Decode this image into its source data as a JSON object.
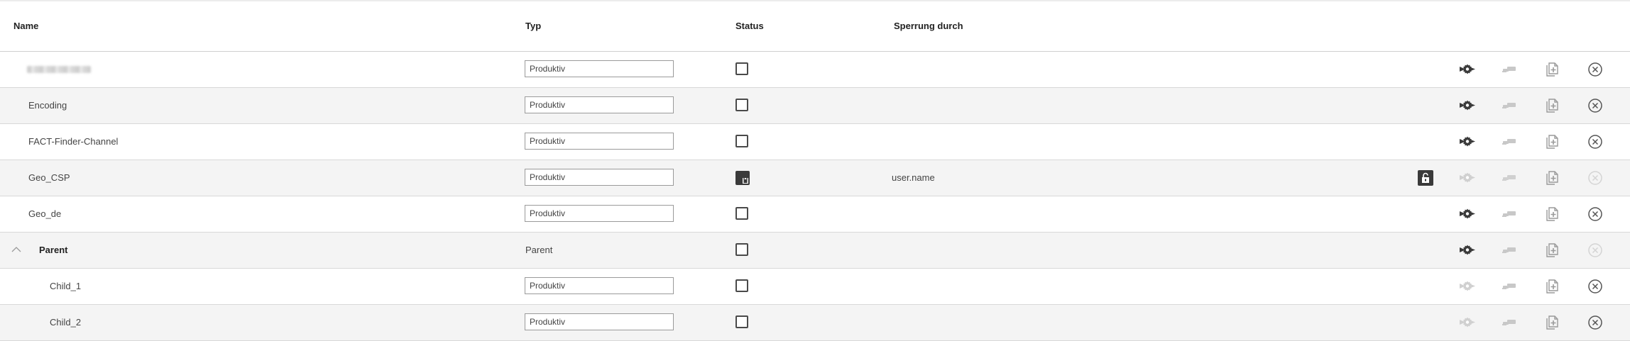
{
  "header": {
    "name": "Name",
    "typ": "Typ",
    "status": "Status",
    "sperrung": "Sperrung durch"
  },
  "rows": [
    {
      "name": "",
      "typ": "Produktiv"
    },
    {
      "name": "Encoding",
      "typ": "Produktiv"
    },
    {
      "name": "FACT-Finder-Channel",
      "typ": "Produktiv"
    },
    {
      "name": "Geo_CSP",
      "typ": "Produktiv",
      "locked_by": "user.name"
    },
    {
      "name": "Geo_de",
      "typ": "Produktiv"
    },
    {
      "name": "Parent",
      "typ": "Parent"
    },
    {
      "name": "Child_1",
      "typ": "Produktiv"
    },
    {
      "name": "Child_2",
      "typ": "Produktiv"
    }
  ],
  "icons": {
    "settings": "settings-arrow-icon",
    "unlock": "unlock-icon",
    "import": "import-icon",
    "copy": "copy-icon",
    "delete": "delete-circle-icon",
    "locked_status": "locked-status-icon",
    "collapse": "chevron-up-icon"
  },
  "colors": {
    "active_icon": "#3a3a3a",
    "inactive_icon": "#c8c8c8",
    "stripe": "#f4f4f4"
  }
}
